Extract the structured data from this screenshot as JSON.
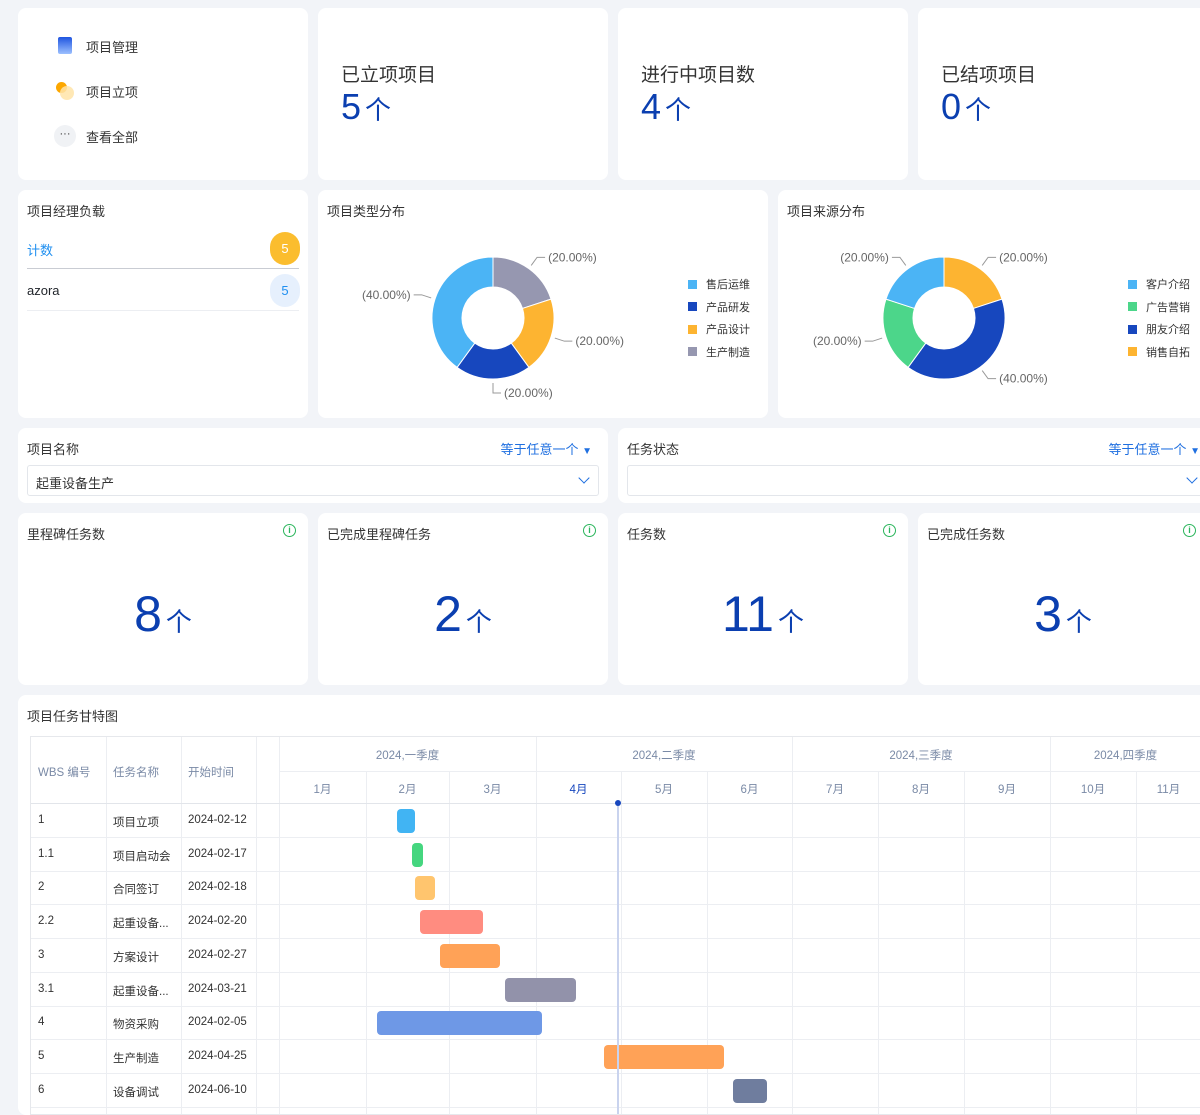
{
  "nav": [
    {
      "label": "项目管理",
      "icon": "document-icon"
    },
    {
      "label": "项目立项",
      "icon": "lightbulb-icon"
    },
    {
      "label": "查看全部",
      "icon": "more-icon"
    }
  ],
  "stats": [
    {
      "title": "已立项项目",
      "value": "5",
      "unit": "个"
    },
    {
      "title": "进行中项目数",
      "value": "4",
      "unit": "个"
    },
    {
      "title": "已结项项目",
      "value": "0",
      "unit": "个"
    }
  ],
  "pm_load": {
    "title": "项目经理负载",
    "header_label": "计数",
    "header_count": "5",
    "rows": [
      {
        "name": "azora",
        "count": "5"
      }
    ]
  },
  "colors": {
    "light_blue": "#4bb4f5",
    "dark_blue": "#1747be",
    "orange": "#fdb431",
    "gray": "#9697b0",
    "green": "#4cd68a",
    "accent": "#0b3fb0"
  },
  "chart_data": [
    {
      "type": "pie",
      "title": "项目类型分布",
      "slices": [
        {
          "name": "生产制造",
          "value": 20,
          "label": "(20.00%)",
          "color": "#9697b0"
        },
        {
          "name": "产品设计",
          "value": 20,
          "label": "(20.00%)",
          "color": "#fdb431"
        },
        {
          "name": "产品研发",
          "value": 20,
          "label": "(20.00%)",
          "color": "#1747be"
        },
        {
          "name": "售后运维",
          "value": 40,
          "label": "(40.00%)",
          "color": "#4bb4f5"
        }
      ],
      "legend": [
        "售后运维",
        "产品研发",
        "产品设计",
        "生产制造"
      ],
      "legend_placement": "right"
    },
    {
      "type": "pie",
      "title": "项目来源分布",
      "slices": [
        {
          "name": "销售自拓",
          "value": 20,
          "label": "(20.00%)",
          "color": "#fdb431"
        },
        {
          "name": "朋友介绍",
          "value": 40,
          "label": "(40.00%)",
          "color": "#1747be"
        },
        {
          "name": "广告营销",
          "value": 20,
          "label": "(20.00%)",
          "color": "#4cd68a"
        },
        {
          "name": "客户介绍",
          "value": 20,
          "label": "(20.00%)",
          "color": "#4bb4f5"
        }
      ],
      "legend": [
        "客户介绍",
        "广告营销",
        "朋友介绍",
        "销售自拓"
      ],
      "legend_placement": "right"
    }
  ],
  "filters": [
    {
      "label": "项目名称",
      "op": "等于任意一个",
      "value": "起重设备生产"
    },
    {
      "label": "任务状态",
      "op": "等于任意一个",
      "value": ""
    }
  ],
  "kpis": [
    {
      "title": "里程碑任务数",
      "value": "8",
      "unit": "个"
    },
    {
      "title": "已完成里程碑任务",
      "value": "2",
      "unit": "个"
    },
    {
      "title": "任务数",
      "value": "11",
      "unit": "个"
    },
    {
      "title": "已完成任务数",
      "value": "3",
      "unit": "个"
    }
  ],
  "gantt": {
    "title": "项目任务甘特图",
    "columns": [
      "WBS 编号",
      "任务名称",
      "开始时间"
    ],
    "quarters": [
      "2024,一季度",
      "2024,二季度",
      "2024,三季度",
      "2024,四季度"
    ],
    "months": [
      "1月",
      "2月",
      "3月",
      "4月",
      "5月",
      "6月",
      "7月",
      "8月",
      "9月",
      "10月",
      "11月"
    ],
    "current_month": "4月",
    "tasks": [
      {
        "wbs": "1",
        "name": "项目立项",
        "start": "2024-02-12",
        "end": "2024-02-18",
        "color": "#41b4f3"
      },
      {
        "wbs": "1.1",
        "name": "项目启动会",
        "start": "2024-02-17",
        "end": "2024-02-21",
        "color": "#45d67f"
      },
      {
        "wbs": "2",
        "name": "合同签订",
        "start": "2024-02-18",
        "end": "2024-02-25",
        "color": "#ffc56e"
      },
      {
        "wbs": "2.2",
        "name": "起重设备...",
        "start": "2024-02-20",
        "end": "2024-03-13",
        "color": "#ff8c80"
      },
      {
        "wbs": "3",
        "name": "方案设计",
        "start": "2024-02-27",
        "end": "2024-03-19",
        "color": "#ffa257"
      },
      {
        "wbs": "3.1",
        "name": "起重设备...",
        "start": "2024-03-21",
        "end": "2024-04-15",
        "color": "#9292aa"
      },
      {
        "wbs": "4",
        "name": "物资采购",
        "start": "2024-02-05",
        "end": "2024-04-03",
        "color": "#6e98e6"
      },
      {
        "wbs": "5",
        "name": "生产制造",
        "start": "2024-04-25",
        "end": "2024-06-07",
        "color": "#ffa257"
      },
      {
        "wbs": "6",
        "name": "设备调试",
        "start": "2024-06-10",
        "end": "2024-06-22",
        "color": "#6f7d9e"
      }
    ]
  }
}
